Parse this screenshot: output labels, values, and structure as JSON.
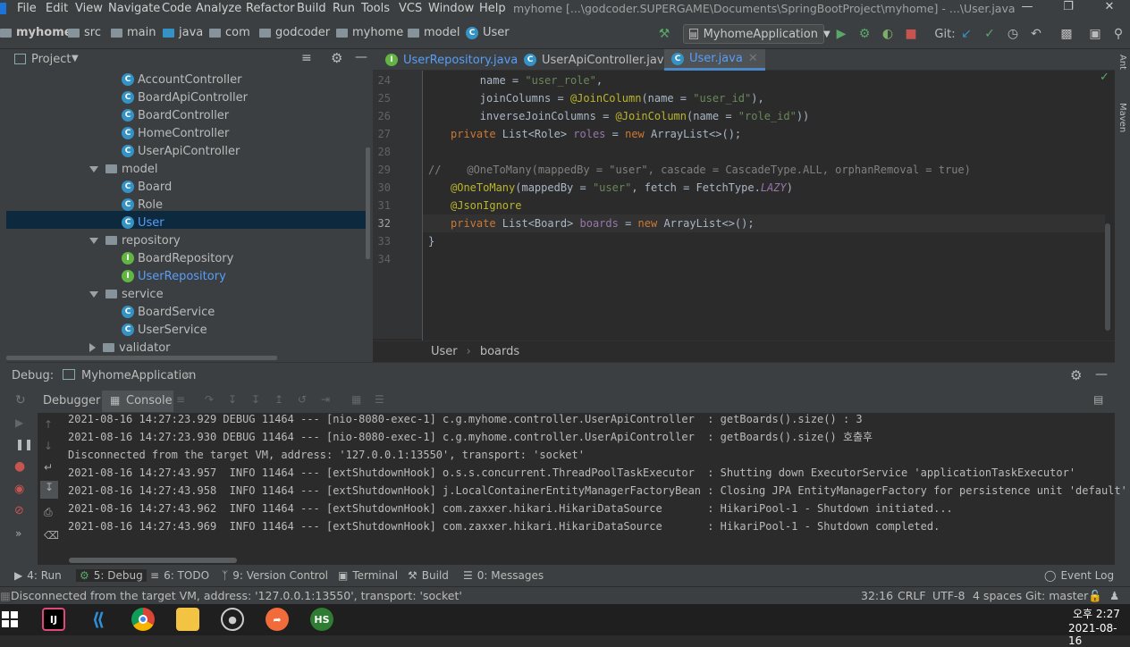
{
  "menubar": {
    "items": [
      "File",
      "Edit",
      "View",
      "Navigate",
      "Code",
      "Analyze",
      "Refactor",
      "Build",
      "Run",
      "Tools",
      "VCS",
      "Window",
      "Help"
    ],
    "title": "myhome [...\\godcoder.SUPERGAME\\Documents\\SpringBootProject\\myhome] - ...\\User.java"
  },
  "breadcrumb": [
    "myhome",
    "src",
    "main",
    "java",
    "com",
    "godcoder",
    "myhome",
    "model",
    "User"
  ],
  "toolbar": {
    "run_config": "MyhomeApplication",
    "git_label": "Git:"
  },
  "project": {
    "title": "Project",
    "tree": [
      {
        "label": "AccountController",
        "kind": "class"
      },
      {
        "label": "BoardApiController",
        "kind": "class"
      },
      {
        "label": "BoardController",
        "kind": "class"
      },
      {
        "label": "HomeController",
        "kind": "class"
      },
      {
        "label": "UserApiController",
        "kind": "class"
      },
      {
        "label": "model",
        "kind": "folder"
      },
      {
        "label": "Board",
        "kind": "class"
      },
      {
        "label": "Role",
        "kind": "class"
      },
      {
        "label": "User",
        "kind": "class",
        "selected": true
      },
      {
        "label": "repository",
        "kind": "folder"
      },
      {
        "label": "BoardRepository",
        "kind": "interface"
      },
      {
        "label": "UserRepository",
        "kind": "interface"
      },
      {
        "label": "service",
        "kind": "folder"
      },
      {
        "label": "BoardService",
        "kind": "class"
      },
      {
        "label": "UserService",
        "kind": "class"
      },
      {
        "label": "validator",
        "kind": "folder-collapsed"
      }
    ]
  },
  "editor": {
    "tabs": [
      {
        "label": "UserRepository.java",
        "icon": "interface"
      },
      {
        "label": "UserApiController.java",
        "icon": "class"
      },
      {
        "label": "User.java",
        "icon": "class",
        "active": true
      }
    ],
    "line_numbers": [
      "24",
      "25",
      "26",
      "27",
      "28",
      "29",
      "30",
      "31",
      "32",
      "33",
      "34"
    ],
    "breadcrumb": [
      "User",
      "boards"
    ]
  },
  "debug": {
    "title": "Debug:",
    "config": "MyhomeApplication",
    "tabs": [
      "Debugger",
      "Console"
    ],
    "console": [
      "2021-08-16 14:27:23.929 DEBUG 11464 --- [nio-8080-exec-1] c.g.myhome.controller.UserApiController  : getBoards().size() : 3",
      "2021-08-16 14:27:23.930 DEBUG 11464 --- [nio-8080-exec-1] c.g.myhome.controller.UserApiController  : getBoards().size() 호출후",
      "Disconnected from the target VM, address: '127.0.0.1:13550', transport: 'socket'",
      "2021-08-16 14:27:43.957  INFO 11464 --- [extShutdownHook] o.s.s.concurrent.ThreadPoolTaskExecutor  : Shutting down ExecutorService 'applicationTaskExecutor'",
      "2021-08-16 14:27:43.958  INFO 11464 --- [extShutdownHook] j.LocalContainerEntityManagerFactoryBean : Closing JPA EntityManagerFactory for persistence unit 'default'",
      "2021-08-16 14:27:43.962  INFO 11464 --- [extShutdownHook] com.zaxxer.hikari.HikariDataSource       : HikariPool-1 - Shutdown initiated...",
      "2021-08-16 14:27:43.969  INFO 11464 --- [extShutdownHook] com.zaxxer.hikari.HikariDataSource       : HikariPool-1 - Shutdown completed."
    ]
  },
  "bottom_tabs": [
    "4: Run",
    "5: Debug",
    "6: TODO",
    "9: Version Control",
    "Terminal",
    "Build",
    "0: Messages"
  ],
  "event_log": "Event Log",
  "status": {
    "message": "Disconnected from the target VM, address: '127.0.0.1:13550', transport: 'socket'",
    "position": "32:16",
    "line_sep": "CRLF",
    "encoding": "UTF-8",
    "indent": "4 spaces",
    "git": "Git: master"
  },
  "taskbar": {
    "time": "오후 2:27",
    "date": "2021-08-16"
  },
  "right_strip": [
    "Ant",
    "Maven"
  ],
  "colors": {
    "accent": "#4a88c7",
    "selection": "#0d293e",
    "run_green": "#59a869",
    "stop_red": "#c75450"
  }
}
